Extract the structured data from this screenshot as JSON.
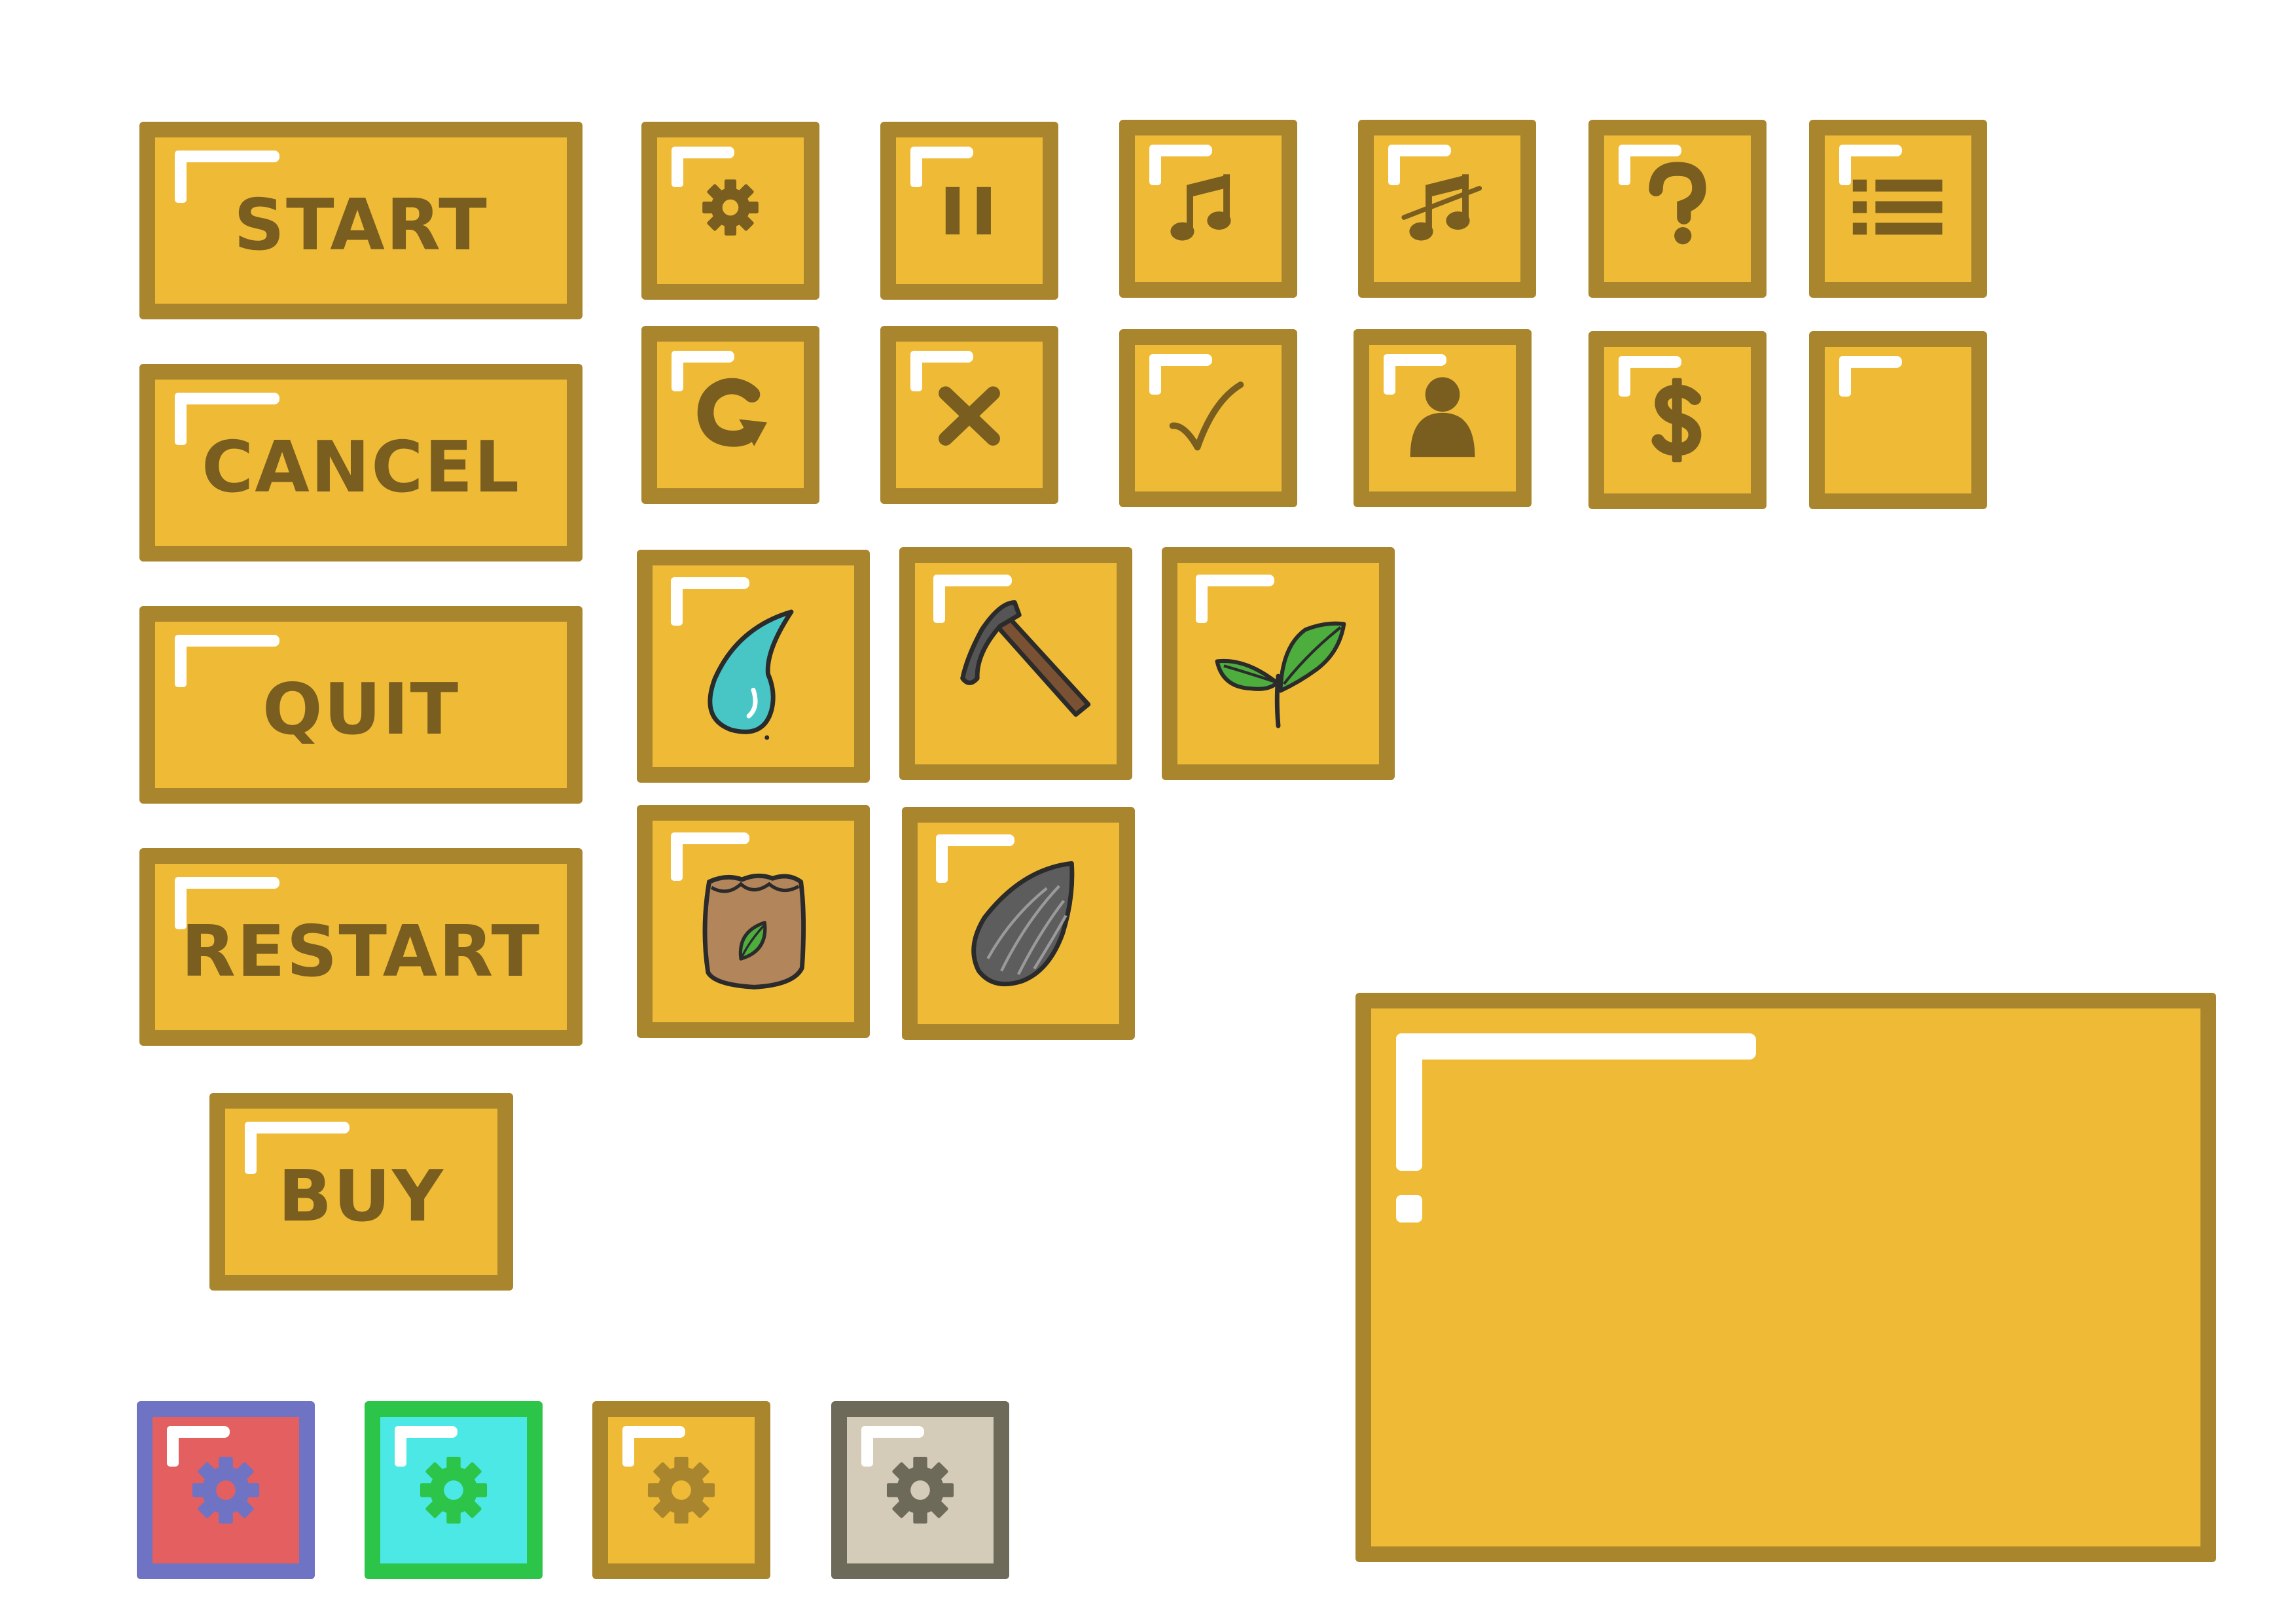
{
  "buttons": {
    "start": "START",
    "cancel": "CANCEL",
    "quit": "QUIT",
    "restart": "RESTART",
    "buy": "BUY"
  },
  "icons": {
    "row1": [
      "gear-icon",
      "pause-icon",
      "music-icon",
      "music-muted-icon",
      "help-icon",
      "menu-list-icon"
    ],
    "row2": [
      "restart-arrow-icon",
      "close-icon",
      "check-icon",
      "user-icon",
      "dollar-icon",
      "empty-slot"
    ],
    "items": [
      "water-drop-icon",
      "hoe-icon",
      "sprout-icon",
      "seed-bag-icon",
      "seed-icon"
    ],
    "color_variants": [
      "gear-icon-red",
      "gear-icon-cyan",
      "gear-icon-yellow",
      "gear-icon-gray"
    ]
  },
  "colors": {
    "tile_fill": "#EFBB37",
    "tile_border": "#A9862E",
    "icon_dark": "#7A5E1F",
    "variant_red": "#E45F5F",
    "variant_blue_border": "#6E73C4",
    "variant_cyan": "#4BE8E6",
    "variant_green_border": "#2DC44A",
    "variant_gray": "#D4CBB8",
    "variant_gray_border": "#6E6A5A"
  }
}
